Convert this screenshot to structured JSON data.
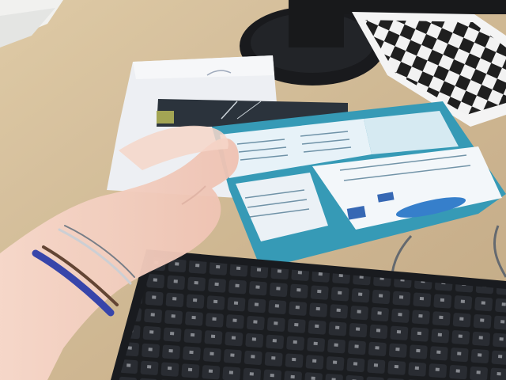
{
  "scene": {
    "colors": {
      "desk": "#cdb58f",
      "desk_light": "#e2d0ad",
      "paper": "#eef0f4",
      "card_teal": "#2b95b3",
      "card_light": "#e8f3f8",
      "card_dark": "#1f2a33",
      "monitor": "#0c0d10",
      "keyboard": "#0d0f13",
      "key": "#1b1e24",
      "skin": "#f3c7b6",
      "bracelet_blue": "#2b3da8",
      "checker": "#111111"
    },
    "icons": [
      "monitor-stand",
      "checkerboard-sheet",
      "paper-sheet",
      "brochure-card",
      "keyboard",
      "hand",
      "bracelets",
      "cable"
    ]
  }
}
